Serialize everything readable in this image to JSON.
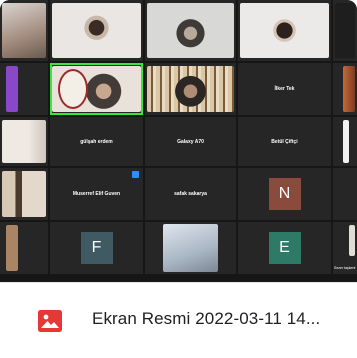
{
  "participants": [
    {
      "name": "İlker Tek"
    },
    {
      "name": "gülşah erdem"
    },
    {
      "name": "Galaxy A70"
    },
    {
      "name": "Betül Çiftçi"
    },
    {
      "name": "Muserref Elif Guven"
    },
    {
      "name": "safak sakarya"
    },
    {
      "name": "Sezer taşkent",
      "initial": "N"
    }
  ],
  "avatars": [
    {
      "initial": "N",
      "color": "#8b4b3c"
    },
    {
      "initial": "F",
      "color": "#3f5a63"
    },
    {
      "initial": "E",
      "color": "#2f7a67"
    }
  ],
  "attachment": {
    "filename": "Ekran Resmi 2022-03-11 14...",
    "icon": "image-icon",
    "icon_color": "#e53935"
  }
}
